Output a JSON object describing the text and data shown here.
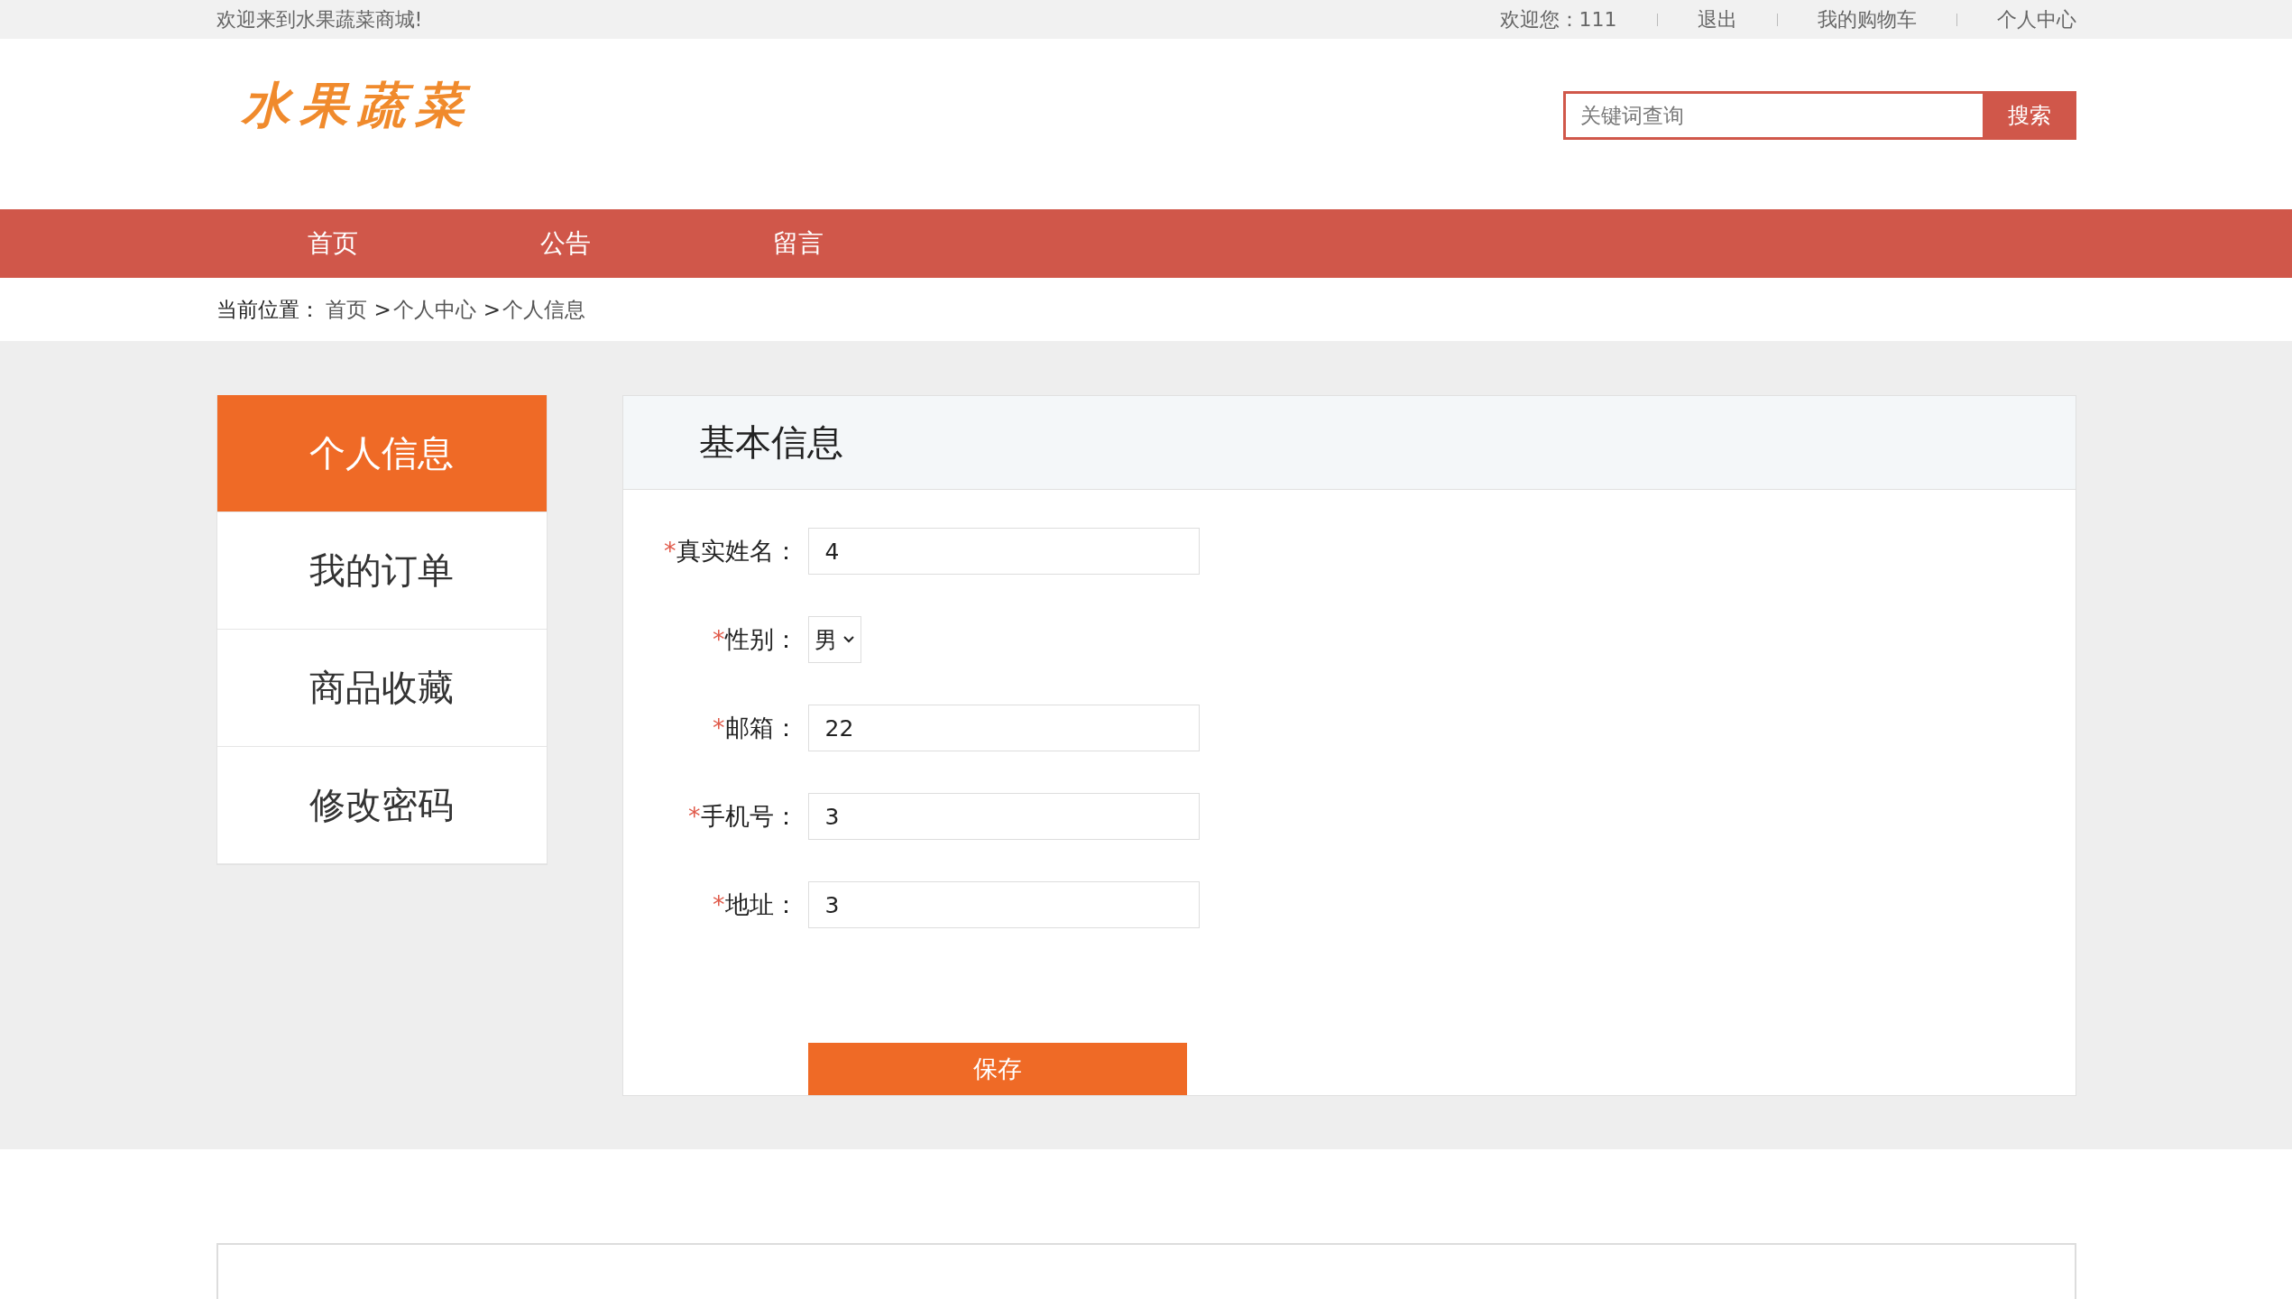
{
  "top_bar": {
    "welcome": "欢迎来到水果蔬菜商城!",
    "user_greeting": "欢迎您：111",
    "links": [
      "退出",
      "我的购物车",
      "个人中心"
    ]
  },
  "header": {
    "logo": "水果蔬菜",
    "search": {
      "placeholder": "关键词查询",
      "button": "搜索"
    }
  },
  "nav": [
    {
      "label": "首页"
    },
    {
      "label": "公告"
    },
    {
      "label": "留言"
    }
  ],
  "breadcrumb": {
    "label": "当前位置：",
    "items": [
      {
        "kind": "link",
        "text": "首页"
      },
      {
        "kind": "separator",
        "text": ">"
      },
      {
        "kind": "link",
        "text": "个人中心"
      },
      {
        "kind": "separator",
        "text": ">"
      },
      {
        "kind": "link",
        "text": "个人信息"
      }
    ]
  },
  "sidebar": [
    {
      "label": "个人信息",
      "selected": true
    },
    {
      "label": "我的订单",
      "selected": false
    },
    {
      "label": "商品收藏",
      "selected": false
    },
    {
      "label": "修改密码",
      "selected": false
    }
  ],
  "panel": {
    "title": "基本信息",
    "fields": [
      {
        "kind": "text",
        "required_mark": "*",
        "label": "真实姓名：",
        "value": "4"
      },
      {
        "kind": "select",
        "required_mark": "*",
        "label": "性别：",
        "value": "男"
      },
      {
        "kind": "text",
        "required_mark": "*",
        "label": "邮箱：",
        "value": "22"
      },
      {
        "kind": "text",
        "required_mark": "*",
        "label": "手机号：",
        "value": "3"
      },
      {
        "kind": "text",
        "required_mark": "*",
        "label": "地址：",
        "value": "3"
      }
    ],
    "save_button": "保存"
  }
}
